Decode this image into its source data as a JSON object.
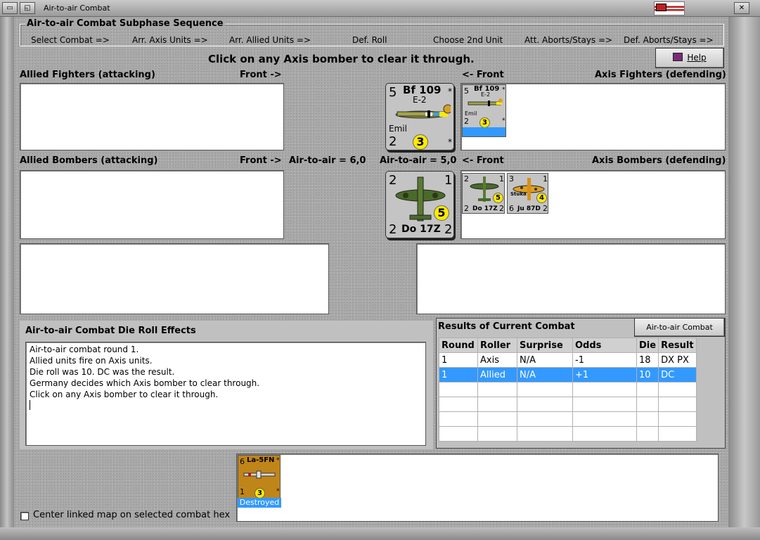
{
  "window": {
    "title": "Air-to-air Combat"
  },
  "sequence": {
    "title": "Air-to-air Combat Subphase Sequence",
    "steps": [
      "Select Combat =>",
      "Arr. Axis Units =>",
      "Arr. Allied Units =>",
      "Def. Roll",
      "Choose 2nd Unit",
      "Att. Aborts/Stays =>",
      "Def. Aborts/Stays =>"
    ]
  },
  "instruction": "Click on any Axis bomber to clear it through.",
  "help_label": "Help",
  "labels": {
    "allied_fighters": "Allied Fighters (attacking)",
    "front_right": "Front ->",
    "front_left": "<- Front",
    "axis_fighters": "Axis Fighters (defending)",
    "allied_bombers": "Allied Bombers (attacking)",
    "front_right_2": "Front ->",
    "air_allied": "Air-to-air = 6,0",
    "air_axis": "Air-to-air = 5,0",
    "front_left_2": "<- Front",
    "axis_bombers": "Axis Bombers (defending)"
  },
  "big_fighter": {
    "tl": "5",
    "name": "Bf 109",
    "sub": "E-2",
    "star1": "*",
    "nick": "Emil",
    "bl": "2",
    "val": "3",
    "star2": "*"
  },
  "big_bomber": {
    "tl": "2",
    "tr": "1",
    "val": "5",
    "bl": "2",
    "name": "Do 17Z",
    "br": "2"
  },
  "axis_fighters": [
    {
      "tl": "5",
      "name": "Bf 109",
      "sub": "E-2",
      "star1": "*",
      "nick": "Emil",
      "bl": "2",
      "val": "3",
      "star2": "*"
    }
  ],
  "axis_bombers": [
    {
      "tl": "2",
      "tr": "1",
      "val": "5",
      "bl": "2",
      "name": "Do 17Z",
      "br": "2"
    },
    {
      "tl": "3",
      "tr": "1",
      "nick": "Stuka",
      "val": "4",
      "bl": "6",
      "name": "Ju 87D",
      "br": "2"
    }
  ],
  "effects": {
    "title": "Air-to-air Combat Die Roll Effects",
    "lines": [
      "Air-to-air combat round 1.",
      "Allied units fire on Axis units.",
      "Die roll was 10.  DC was the result.",
      "Germany decides which Axis bomber to clear through.",
      "Click on any Axis bomber to clear it through."
    ]
  },
  "results": {
    "title": "Results of Current Combat",
    "chart_button": "Air-to-air Combat Chart",
    "columns": [
      "Round",
      "Roller",
      "Surprise",
      "Odds",
      "Die",
      "Result"
    ],
    "rows": [
      [
        "1",
        "Axis",
        "N/A",
        "-1",
        "18",
        "DX PX"
      ],
      [
        "1",
        "Allied",
        "N/A",
        "+1",
        "10",
        "DC"
      ]
    ]
  },
  "destroyed": {
    "tl": "6",
    "name": "La-5FN",
    "star1": "*",
    "bl": "1",
    "val": "3",
    "star2": "*",
    "status": "Destroyed"
  },
  "center_checkbox": "Center linked map on selected combat hex",
  "colors": {
    "selection": "#3399ff",
    "counter": "#c4c4c4",
    "soviet": "#c08518",
    "yellow": "#ffea00"
  }
}
